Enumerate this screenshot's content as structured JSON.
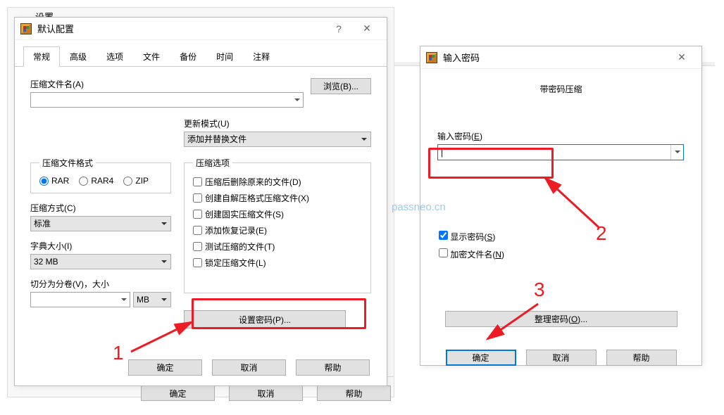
{
  "bg_title": "设置",
  "bg_btn_ok": "确定",
  "bg_btn_cancel": "取消",
  "bg_btn_help": "帮助",
  "dialog1": {
    "title": "默认配置",
    "tabs": [
      "常规",
      "高级",
      "选项",
      "文件",
      "备份",
      "时间",
      "注释"
    ],
    "filename_label": "压缩文件名(A)",
    "browse_btn": "浏览(B)...",
    "update_label": "更新模式(U)",
    "update_value": "添加并替换文件",
    "format_legend": "压缩文件格式",
    "format_rar": "RAR",
    "format_rar4": "RAR4",
    "format_zip": "ZIP",
    "options_legend": "压缩选项",
    "opt1": "压缩后删除原来的文件(D)",
    "opt2": "创建自解压格式压缩文件(X)",
    "opt3": "创建固实压缩文件(S)",
    "opt4": "添加恢复记录(E)",
    "opt5": "测试压缩的文件(T)",
    "opt6": "锁定压缩文件(L)",
    "method_label": "压缩方式(C)",
    "method_value": "标准",
    "dict_label": "字典大小(I)",
    "dict_value": "32 MB",
    "split_label": "切分为分卷(V)，大小",
    "split_unit": "MB",
    "set_password_btn": "设置密码(P)...",
    "ok": "确定",
    "cancel": "取消",
    "help": "帮助"
  },
  "dialog2": {
    "title": "输入密码",
    "heading": "带密码压缩",
    "pw_label_pre": "输入密码(",
    "pw_label_u": "E",
    "pw_label_post": ")",
    "show_pw_pre": "显示密码(",
    "show_pw_u": "S",
    "show_pw_post": ")",
    "encrypt_names_pre": "加密文件名(",
    "encrypt_names_u": "N",
    "encrypt_names_post": ")",
    "manage_btn_pre": "整理密码(",
    "manage_btn_u": "O",
    "manage_btn_post": ")...",
    "ok": "确定",
    "cancel": "取消",
    "help": "帮助"
  },
  "watermark": "passneo.cn",
  "annot": {
    "n1": "1",
    "n2": "2",
    "n3": "3"
  }
}
